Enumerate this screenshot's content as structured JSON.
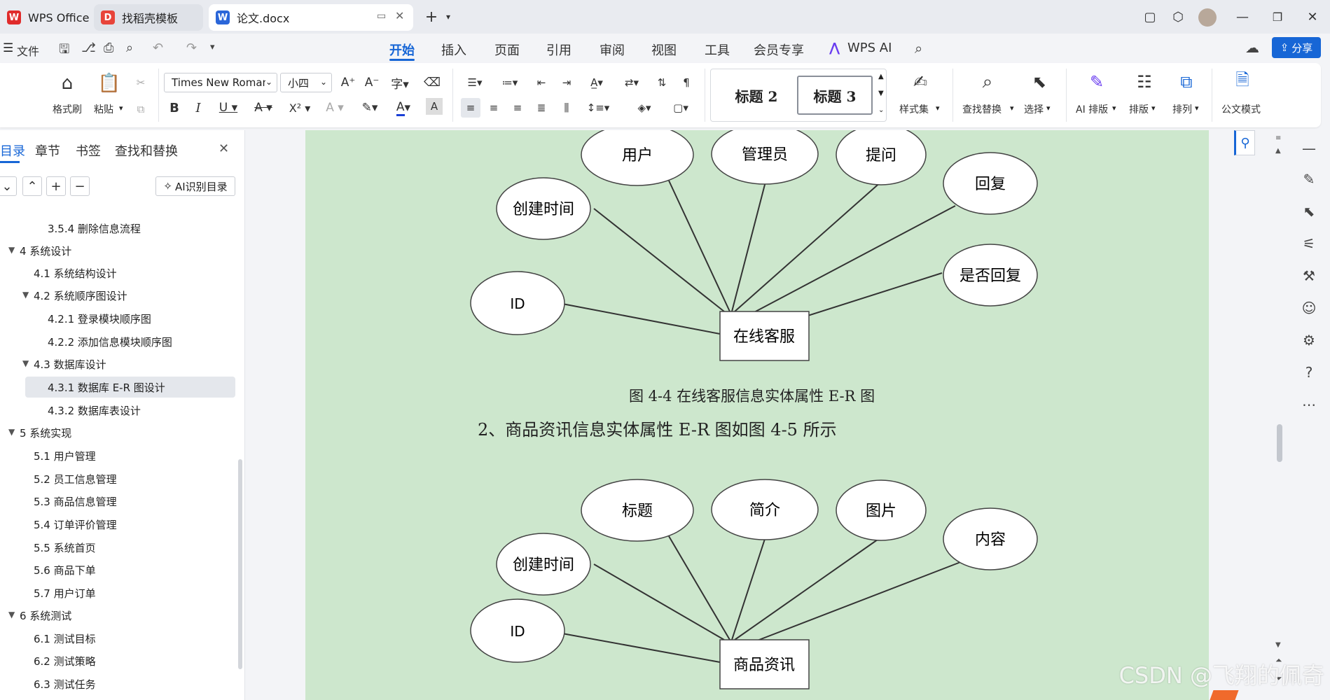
{
  "tabs": [
    {
      "label": "WPS Office",
      "icon": "wps-logo-icon"
    },
    {
      "label": "找稻壳模板",
      "icon": "docer-logo-icon"
    },
    {
      "label": "论文.docx",
      "icon": "word-doc-icon"
    }
  ],
  "menu": {
    "file": "文件",
    "items": [
      "开始",
      "插入",
      "页面",
      "引用",
      "审阅",
      "视图",
      "工具",
      "会员专享"
    ],
    "active": "开始",
    "wps_ai": "WPS AI",
    "share": "分享"
  },
  "ribbon": {
    "format_painter": "格式刷",
    "paste": "粘贴",
    "font_name": "Times New Roman",
    "font_size": "小四",
    "style_heading2": "标题 2",
    "style_heading3": "标题 3",
    "style_set": "样式集",
    "find_replace": "查找替换",
    "select": "选择",
    "ai_layout": "AI 排版",
    "layout": "排版",
    "arrange": "排列",
    "official_mode": "公文模式"
  },
  "sidebar": {
    "tabs": [
      "目录",
      "章节",
      "书签",
      "查找和替换"
    ],
    "ai_toc": "AI识别目录",
    "toc": [
      {
        "level": 3,
        "text": "3.5.4  删除信息流程"
      },
      {
        "level": 1,
        "text": "4  系统设计",
        "expanded": true
      },
      {
        "level": 2,
        "text": "4.1  系统结构设计"
      },
      {
        "level": 2,
        "text": "4.2  系统顺序图设计",
        "expanded": true
      },
      {
        "level": 3,
        "text": "4.2.1 登录模块顺序图"
      },
      {
        "level": 3,
        "text": "4.2.2 添加信息模块顺序图"
      },
      {
        "level": 2,
        "text": "4.3  数据库设计",
        "expanded": true
      },
      {
        "level": 3,
        "text": "4.3.1 数据库 E-R 图设计",
        "selected": true
      },
      {
        "level": 3,
        "text": "4.3.2 数据库表设计"
      },
      {
        "level": 1,
        "text": "5  系统实现",
        "expanded": true
      },
      {
        "level": 2,
        "text": "5.1  用户管理"
      },
      {
        "level": 2,
        "text": "5.2  员工信息管理"
      },
      {
        "level": 2,
        "text": "5.3  商品信息管理"
      },
      {
        "level": 2,
        "text": "5.4  订单评价管理"
      },
      {
        "level": 2,
        "text": "5.5  系统首页"
      },
      {
        "level": 2,
        "text": "5.6 商品下单"
      },
      {
        "level": 2,
        "text": "5.7 用户订单"
      },
      {
        "level": 1,
        "text": "6  系统测试",
        "expanded": true
      },
      {
        "level": 2,
        "text": "6.1  测试目标"
      },
      {
        "level": 2,
        "text": "6.2  测试策略"
      },
      {
        "level": 2,
        "text": "6.3  测试任务"
      }
    ]
  },
  "document": {
    "er1": {
      "entity": "在线客服",
      "attributes": [
        "用户",
        "管理员",
        "提问",
        "回复",
        "创建时间",
        "是否回复",
        "ID"
      ]
    },
    "caption1": "图 4-4  在线客服信息实体属性 E-R 图",
    "paragraph": "2、商品资讯信息实体属性 E-R 图如图 4-5 所示",
    "er2": {
      "entity": "商品资讯",
      "attributes": [
        "标题",
        "简介",
        "图片",
        "内容",
        "创建时间",
        "ID"
      ]
    }
  },
  "watermark": "CSDN @飞翔的佩奇"
}
